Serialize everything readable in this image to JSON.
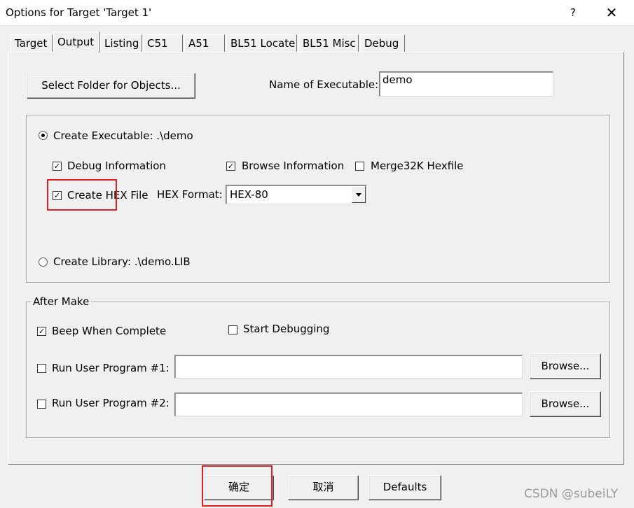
{
  "window": {
    "title": "Options for Target 'Target 1'",
    "help_glyph": "?",
    "close_glyph": "✕"
  },
  "tabs": [
    {
      "label": "Target",
      "active": false
    },
    {
      "label": "Output",
      "active": true
    },
    {
      "label": "Listing",
      "active": false
    },
    {
      "label": "C51",
      "active": false
    },
    {
      "label": "A51",
      "active": false
    },
    {
      "label": "BL51 Locate",
      "active": false
    },
    {
      "label": "BL51 Misc",
      "active": false
    },
    {
      "label": "Debug",
      "active": false
    }
  ],
  "output": {
    "select_folder_label": "Select Folder for Objects...",
    "name_of_executable_label": "Name of Executable:",
    "name_of_executable_value": "demo",
    "create_executable_label": "Create Executable:  .\\demo",
    "create_executable_selected": true,
    "debug_info_label": "Debug Information",
    "debug_info_checked": true,
    "browse_info_label": "Browse Information",
    "browse_info_checked": true,
    "merge32k_label": "Merge32K Hexfile",
    "merge32k_checked": false,
    "create_hex_label": "Create HEX File",
    "create_hex_checked": true,
    "hex_format_label": "HEX Format:",
    "hex_format_value": "HEX-80",
    "create_library_label": "Create Library:  .\\demo.LIB",
    "create_library_selected": false
  },
  "after_make": {
    "legend": "After Make",
    "beep_label": "Beep When Complete",
    "beep_checked": true,
    "start_debugging_label": "Start Debugging",
    "start_debugging_checked": false,
    "run_user_1_label": "Run User Program #1:",
    "run_user_1_checked": false,
    "run_user_1_value": "",
    "run_user_2_label": "Run User Program #2:",
    "run_user_2_checked": false,
    "run_user_2_value": "",
    "browse_label": "Browse..."
  },
  "footer": {
    "ok_label": "确定",
    "cancel_label": "取消",
    "defaults_label": "Defaults"
  },
  "watermark": "CSDN @subeiLY",
  "colors": {
    "highlight_box": "#e02020",
    "dialog_bg": "#f0f0f0"
  }
}
